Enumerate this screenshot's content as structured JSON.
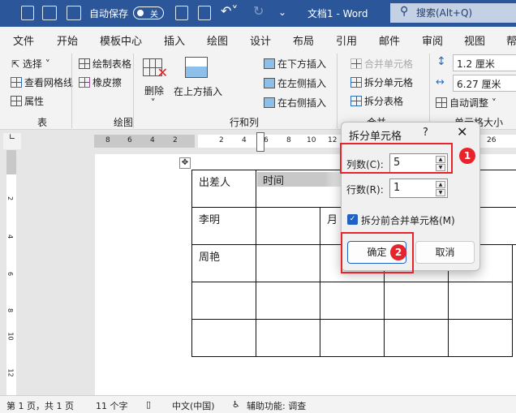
{
  "titlebar": {
    "autosave_label": "自动保存",
    "autosave_state": "关",
    "title": "文档1 - Word",
    "search": "搜索(Alt+Q)"
  },
  "menu": [
    "文件",
    "开始",
    "模板中心",
    "插入",
    "绘图",
    "设计",
    "布局",
    "引用",
    "邮件",
    "审阅",
    "视图",
    "帮"
  ],
  "ribbon": {
    "table_group": {
      "select": "选择",
      "gridlines": "查看网格线",
      "properties": "属性",
      "label": "表"
    },
    "draw_group": {
      "draw_table": "绘制表格",
      "eraser": "橡皮擦",
      "label": "绘图"
    },
    "rows_cols": {
      "delete": "删除",
      "insert_above": "在上方插入",
      "insert_below": "在下方插入",
      "insert_left": "在左侧插入",
      "insert_right": "在右侧插入",
      "label": "行和列"
    },
    "merge": {
      "merge_cells": "合并单元格",
      "split_cells": "拆分单元格",
      "split_table": "拆分表格",
      "label": "合并"
    },
    "cell_size": {
      "height": "1.2 厘米",
      "width": "6.27 厘米",
      "autofit": "自动调整",
      "label": "单元格大小"
    }
  },
  "ruler": {
    "left_ticks": [
      "8",
      "6",
      "4",
      "2"
    ],
    "right_ticks": [
      "2",
      "4",
      "6",
      "8",
      "10",
      "12"
    ],
    "far_tick": "26",
    "vticks": [
      "2",
      "4",
      "6",
      "8",
      "10",
      "12"
    ]
  },
  "table": {
    "r1c1": "出差人",
    "r1c2": "时间",
    "r2c1": "李明",
    "r2c3": "月",
    "r3c1": "周艳"
  },
  "dialog": {
    "title": "拆分单元格",
    "help": "?",
    "cols_label": "列数(C):",
    "cols_value": "5",
    "rows_label": "行数(R):",
    "rows_value": "1",
    "merge_before": "拆分前合并单元格(M)",
    "merge_checked": true,
    "ok": "确定",
    "cancel": "取消"
  },
  "annotations": {
    "badge1": "1",
    "badge2": "2",
    "color": "#e8232b"
  },
  "status": {
    "page": "第 1 页，共 1 页",
    "words": "11 个字",
    "language": "中文(中国)",
    "accessibility": "辅助功能: 调查"
  }
}
